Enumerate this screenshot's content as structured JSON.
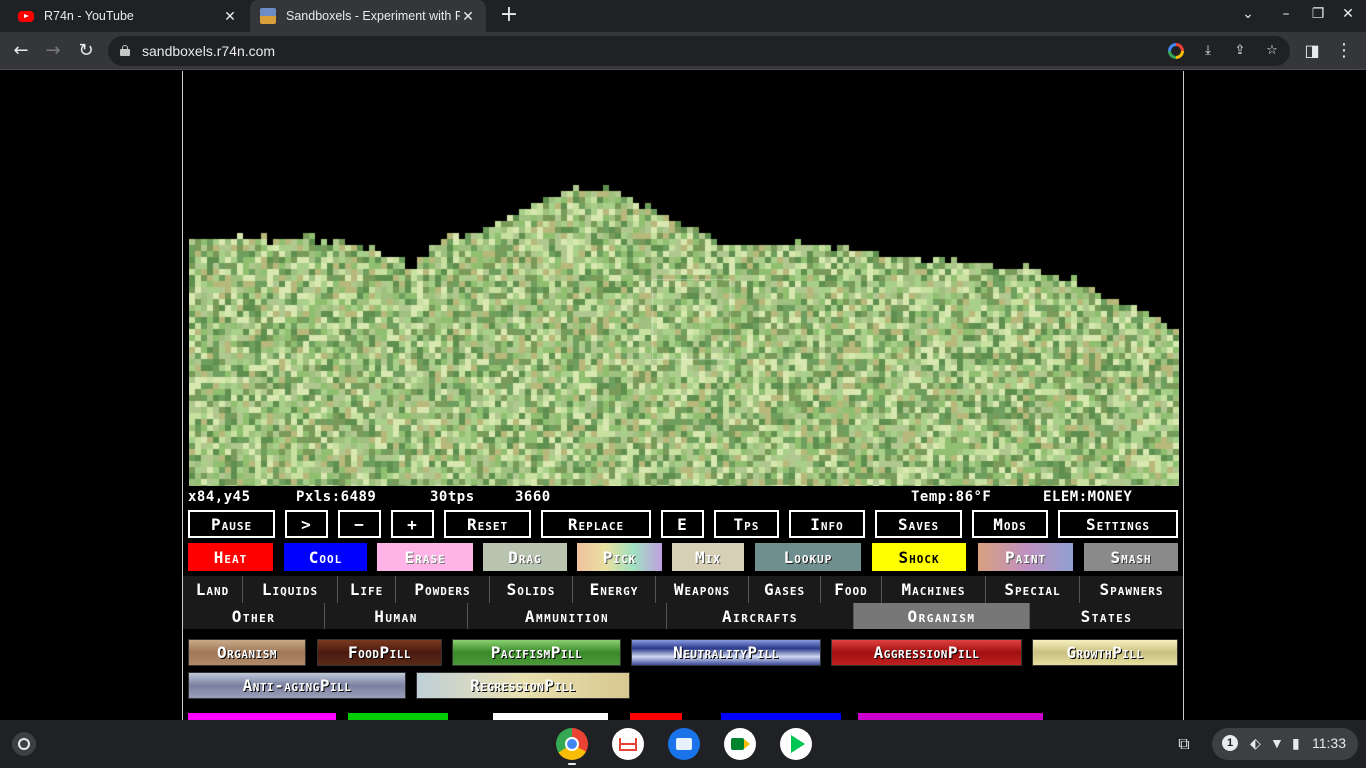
{
  "browser": {
    "tabs": [
      {
        "title": "R74n - YouTube",
        "active": false
      },
      {
        "title": "Sandboxels - Experiment with Pi",
        "active": true
      }
    ],
    "url": "sandboxels.r74n.com"
  },
  "game": {
    "status": {
      "coords": "x84,y45",
      "pixels": "Pxls:6489",
      "tps": "30tps",
      "ticks": "3660",
      "temp": "Temp:86°F",
      "elem": "ELEM:MONEY"
    },
    "controls": [
      "Pause",
      ">",
      "−",
      "+",
      "Reset",
      "Replace",
      "E",
      "Tps",
      "Info",
      "Saves",
      "Mods",
      "Settings"
    ],
    "tools": [
      {
        "label": "Heat",
        "color": "#ff0000"
      },
      {
        "label": "Cool",
        "color": "#0000ff"
      },
      {
        "label": "Erase",
        "color": "#ffb3e6"
      },
      {
        "label": "Drag",
        "color": "#b8c4b0"
      },
      {
        "label": "Pick",
        "color": "#e3d3a0"
      },
      {
        "label": "Mix",
        "color": "#d8cfb7"
      },
      {
        "label": "Lookup",
        "color": "#6f8f8f"
      },
      {
        "label": "Shock",
        "color": "#ffff00"
      },
      {
        "label": "Paint",
        "color": "#c896b0"
      },
      {
        "label": "Smash",
        "color": "#8a8a8a"
      }
    ],
    "categories": [
      "Land",
      "Liquids",
      "Life",
      "Powders",
      "Solids",
      "Energy",
      "Weapons",
      "Gases",
      "Food",
      "Machines",
      "Special",
      "Spawners"
    ],
    "subcategories": [
      "Other",
      "Human",
      "Ammunition",
      "Aircrafts",
      "Organism",
      "States"
    ],
    "selected_subcategory": "Organism",
    "elements": [
      {
        "label": "Organism",
        "color": "#b08a6a"
      },
      {
        "label": "FoodPill",
        "color": "#5a2a18"
      },
      {
        "label": "PacifismPill",
        "color": "#4a9a3a"
      },
      {
        "label": "NeutralityPill",
        "color": "#3a4a9a"
      },
      {
        "label": "AggressionPill",
        "color": "#c02020"
      },
      {
        "label": "GrowthPill",
        "color": "#e8e0a0"
      },
      {
        "label": "Anti-agingPill",
        "color": "#9aa0b8"
      },
      {
        "label": "RegressionPill",
        "color": "#d8d0a0"
      }
    ],
    "cutoff_colors": [
      "#ff00ff",
      "#00cc00",
      "#ffffff",
      "#ff0000",
      "#0000ff",
      "#cc00cc"
    ],
    "canvas_colors": [
      "#8fbf6f",
      "#a8d08a",
      "#6f9f5f",
      "#c8e0a0",
      "#b8b87a",
      "#7a9a5a",
      "#d8e8b0",
      "#5f8f4f",
      "#9fc07f",
      "#b0c890"
    ]
  },
  "shelf": {
    "time": "11:33",
    "notifications": "1",
    "apps": [
      "chrome-icon",
      "gmail-icon",
      "files-icon",
      "meet-icon",
      "play-store-icon"
    ]
  }
}
